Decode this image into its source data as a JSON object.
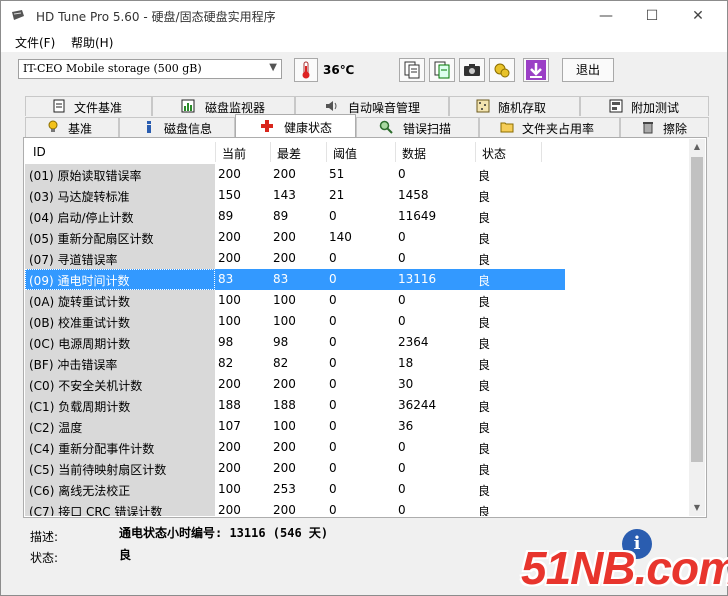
{
  "window": {
    "title": "HD Tune Pro 5.60 - 硬盘/固态硬盘实用程序",
    "minimize": "—",
    "maximize": "☐",
    "close": "✕"
  },
  "menu": {
    "file": "文件(F)",
    "help": "帮助(H)"
  },
  "toolbar": {
    "drive": "IT-CEO  Mobile storage (500 gB)",
    "temperature": "36℃",
    "exit_label": "退出",
    "buttons": [
      "copy-text-icon",
      "copy-all-icon",
      "screenshot-icon",
      "options-icon",
      "save-icon"
    ]
  },
  "tabs_row1": [
    {
      "label": "文件基准",
      "icon": "doc-icon"
    },
    {
      "label": "磁盘监视器",
      "icon": "monitor-icon"
    },
    {
      "label": "自动噪音管理",
      "icon": "speaker-icon"
    },
    {
      "label": "随机存取",
      "icon": "random-icon"
    },
    {
      "label": "附加测试",
      "icon": "extra-icon"
    }
  ],
  "tabs_row2": [
    {
      "label": "基准",
      "icon": "bulb-icon"
    },
    {
      "label": "磁盘信息",
      "icon": "info-icon"
    },
    {
      "label": "健康状态",
      "icon": "health-cross-icon"
    },
    {
      "label": "错误扫描",
      "icon": "magnifier-icon"
    },
    {
      "label": "文件夹占用率",
      "icon": "folder-icon"
    },
    {
      "label": "擦除",
      "icon": "trash-icon"
    }
  ],
  "table": {
    "columns": [
      "ID",
      "当前",
      "最差",
      "阈值",
      "数据",
      "状态"
    ],
    "rows": [
      [
        "(01) 原始读取错误率",
        "200",
        "200",
        "51",
        "0",
        "良"
      ],
      [
        "(03) 马达旋转标准",
        "150",
        "143",
        "21",
        "1458",
        "良"
      ],
      [
        "(04) 启动/停止计数",
        "89",
        "89",
        "0",
        "11649",
        "良"
      ],
      [
        "(05) 重新分配扇区计数",
        "200",
        "200",
        "140",
        "0",
        "良"
      ],
      [
        "(07) 寻道错误率",
        "200",
        "200",
        "0",
        "0",
        "良"
      ],
      [
        "(09) 通电时间计数",
        "83",
        "83",
        "0",
        "13116",
        "良"
      ],
      [
        "(0A) 旋转重试计数",
        "100",
        "100",
        "0",
        "0",
        "良"
      ],
      [
        "(0B) 校准重试计数",
        "100",
        "100",
        "0",
        "0",
        "良"
      ],
      [
        "(0C) 电源周期计数",
        "98",
        "98",
        "0",
        "2364",
        "良"
      ],
      [
        "(BF) 冲击错误率",
        "82",
        "82",
        "0",
        "18",
        "良"
      ],
      [
        "(C0) 不安全关机计数",
        "200",
        "200",
        "0",
        "30",
        "良"
      ],
      [
        "(C1) 负载周期计数",
        "188",
        "188",
        "0",
        "36244",
        "良"
      ],
      [
        "(C2) 温度",
        "107",
        "100",
        "0",
        "36",
        "良"
      ],
      [
        "(C4) 重新分配事件计数",
        "200",
        "200",
        "0",
        "0",
        "良"
      ],
      [
        "(C5) 当前待映射扇区计数",
        "200",
        "200",
        "0",
        "0",
        "良"
      ],
      [
        "(C6) 离线无法校正",
        "100",
        "253",
        "0",
        "0",
        "良"
      ],
      [
        "(C7) 接口 CRC 错误计数",
        "200",
        "200",
        "0",
        "0",
        "良"
      ]
    ],
    "selected_row": 5
  },
  "footer": {
    "desc_label": "描述:",
    "desc_value": "通电状态小时编号: 13116 (546 天)",
    "status_label": "状态:",
    "status_value": "良"
  },
  "watermark": "51NB.com",
  "colors": {
    "selection": "#3399ff",
    "health_cross": "#d9261c",
    "watermark": "#e8352d"
  }
}
